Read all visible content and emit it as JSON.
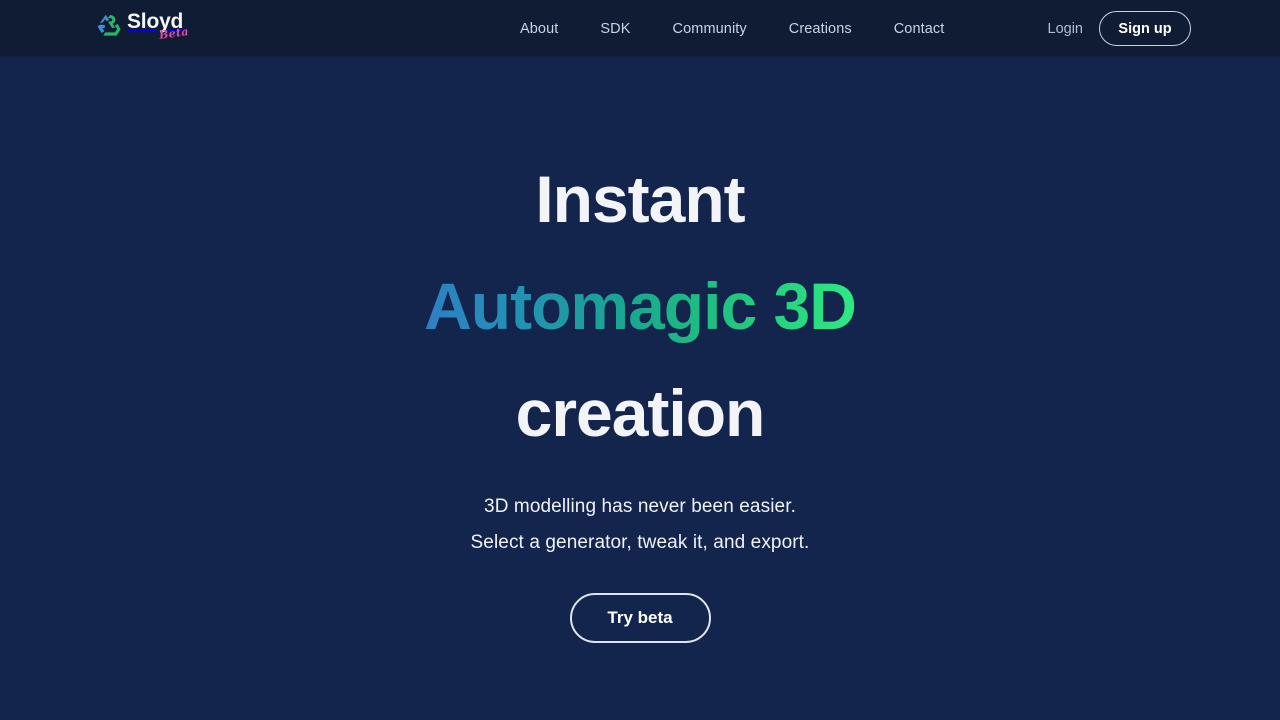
{
  "header": {
    "brand": {
      "name": "Sloyd",
      "badge": "Beta",
      "logo_icon": "sloyd-recycle-mark",
      "logo_colors": {
        "blue": "#2f7fc4",
        "green": "#27b765"
      },
      "badge_color": "#e04ba4"
    },
    "nav": [
      {
        "label": "About"
      },
      {
        "label": "SDK"
      },
      {
        "label": "Community"
      },
      {
        "label": "Creations"
      },
      {
        "label": "Contact"
      }
    ],
    "login_label": "Login",
    "signup_label": "Sign up",
    "background_color": "#101c33"
  },
  "hero": {
    "headline": {
      "line1": "Instant",
      "line2": "Automagic 3D",
      "line3": "creation",
      "gradient_from": "#2f7fc4",
      "gradient_mid": "#19a88e",
      "gradient_to": "#2fe884"
    },
    "subtitle": {
      "line1": "3D modelling has never been easier.",
      "line2": "Select a generator, tweak it, and export."
    },
    "cta_label": "Try beta",
    "background_color": "#14254d"
  }
}
